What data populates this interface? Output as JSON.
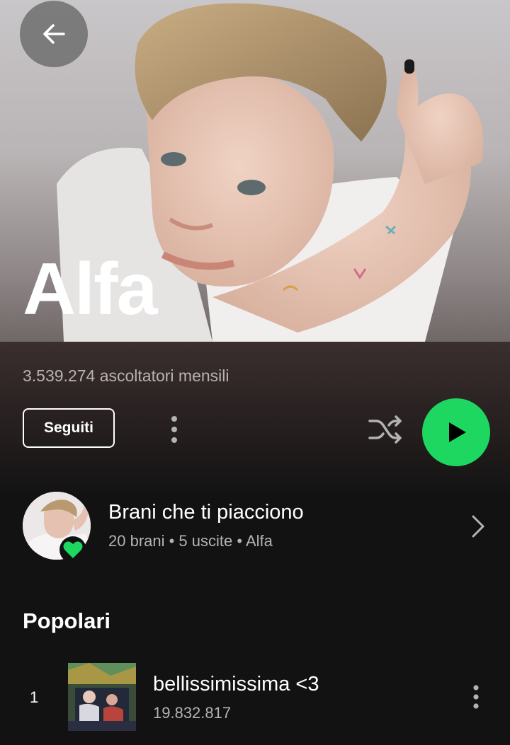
{
  "artist": {
    "name": "Alfa",
    "monthly_listeners": "3.539.274 ascoltatori mensili"
  },
  "actions": {
    "follow_label": "Seguiti"
  },
  "liked_songs": {
    "title": "Brani che ti piacciono",
    "subtitle": "20 brani • 5 uscite • Alfa"
  },
  "popular": {
    "title": "Popolari",
    "tracks": [
      {
        "rank": "1",
        "title": "bellissimissima <3",
        "plays": "19.832.817"
      }
    ]
  },
  "colors": {
    "accent": "#1ed760",
    "background": "#121212",
    "secondary_text": "#b3b3b3"
  },
  "icons": [
    "back-arrow-icon",
    "more-vertical-icon",
    "shuffle-icon",
    "play-icon",
    "heart-icon",
    "chevron-right-icon"
  ]
}
